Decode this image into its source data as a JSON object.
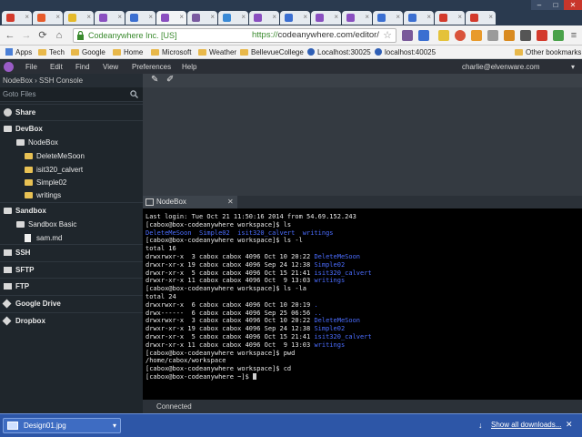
{
  "browser": {
    "ev_badge": "Codeanywhere Inc. [US]",
    "url_scheme": "https://",
    "url_rest": "codeanywhere.com/editor/"
  },
  "bookmarks": [
    "Apps",
    "Tech",
    "Google",
    "Home",
    "Microsoft",
    "Weather",
    "BellevueCollege",
    "Localhost:30025",
    "localhost:40025",
    "Other bookmarks"
  ],
  "app": {
    "menu": [
      "File",
      "Edit",
      "Find",
      "View",
      "Preferences",
      "Help"
    ],
    "user": "charlie@elvenware.com"
  },
  "sidebar": {
    "breadcrumb": "NodeBox › SSH Console",
    "goto_label": "Goto Files",
    "items": [
      {
        "label": "Share",
        "kind": "section",
        "icon": "share-icon"
      },
      {
        "label": "DevBox",
        "kind": "section",
        "icon": "devbox-icon"
      },
      {
        "label": "NodeBox",
        "kind": "container",
        "icon": "container-icon"
      },
      {
        "label": "DeleteMeSoon",
        "kind": "folder",
        "icon": "folder-icon"
      },
      {
        "label": "isit320_calvert",
        "kind": "folder",
        "icon": "folder-icon"
      },
      {
        "label": "Simple02",
        "kind": "folder",
        "icon": "folder-icon"
      },
      {
        "label": "writings",
        "kind": "folder",
        "icon": "folder-icon"
      },
      {
        "label": "Sandbox",
        "kind": "section",
        "icon": "sandbox-icon"
      },
      {
        "label": "Sandbox Basic",
        "kind": "container",
        "icon": "container-icon"
      },
      {
        "label": "sam.md",
        "kind": "file",
        "icon": "file-icon"
      },
      {
        "label": "SSH",
        "kind": "section",
        "icon": "ssh-icon"
      },
      {
        "label": "SFTP",
        "kind": "section",
        "icon": "sftp-icon"
      },
      {
        "label": "FTP",
        "kind": "section",
        "icon": "ftp-icon"
      },
      {
        "label": "Google Drive",
        "kind": "section",
        "icon": "google-drive-icon"
      },
      {
        "label": "Dropbox",
        "kind": "section",
        "icon": "dropbox-icon"
      }
    ]
  },
  "terminal": {
    "tab_label": "NodeBox",
    "status": "Connected",
    "lines": [
      [
        [
          "Last login: Tue Oct 21 11:50:16 2014 from 54.69.152.243",
          ""
        ]
      ],
      [
        [
          "[cabox@box-codeanywhere workspace]$ ls",
          ""
        ]
      ],
      [
        [
          "DeleteMeSoon  Simple02  isit320_calvert  writings",
          "blue"
        ]
      ],
      [
        [
          "[cabox@box-codeanywhere workspace]$ ls -l",
          ""
        ]
      ],
      [
        [
          "total 16",
          ""
        ]
      ],
      [
        [
          "drwxrwxr-x  3 cabox cabox 4096 Oct 10 20:22 ",
          ""
        ],
        [
          "DeleteMeSoon",
          "blue"
        ]
      ],
      [
        [
          "drwxr-xr-x 19 cabox cabox 4096 Sep 24 12:38 ",
          ""
        ],
        [
          "Simple02",
          "blue"
        ]
      ],
      [
        [
          "drwxr-xr-x  5 cabox cabox 4096 Oct 15 21:41 ",
          ""
        ],
        [
          "isit320_calvert",
          "blue"
        ]
      ],
      [
        [
          "drwxr-xr-x 11 cabox cabox 4096 Oct  9 13:03 ",
          ""
        ],
        [
          "writings",
          "blue"
        ]
      ],
      [
        [
          "[cabox@box-codeanywhere workspace]$ ls -la",
          ""
        ]
      ],
      [
        [
          "total 24",
          ""
        ]
      ],
      [
        [
          "drwxrwxr-x  6 cabox cabox 4096 Oct 10 20:19 ",
          ""
        ],
        [
          ".",
          "blue"
        ]
      ],
      [
        [
          "drwx------  6 cabox cabox 4096 Sep 25 06:56 ",
          ""
        ],
        [
          "..",
          "blue"
        ]
      ],
      [
        [
          "drwxrwxr-x  3 cabox cabox 4096 Oct 10 20:22 ",
          ""
        ],
        [
          "DeleteMeSoon",
          "blue"
        ]
      ],
      [
        [
          "drwxr-xr-x 19 cabox cabox 4096 Sep 24 12:38 ",
          ""
        ],
        [
          "Simple02",
          "blue"
        ]
      ],
      [
        [
          "drwxr-xr-x  5 cabox cabox 4096 Oct 15 21:41 ",
          ""
        ],
        [
          "isit320_calvert",
          "blue"
        ]
      ],
      [
        [
          "drwxr-xr-x 11 cabox cabox 4096 Oct  9 13:03 ",
          ""
        ],
        [
          "writings",
          "blue"
        ]
      ],
      [
        [
          "[cabox@box-codeanywhere workspace]$ pwd",
          ""
        ]
      ],
      [
        [
          "/home/cabox/workspace",
          ""
        ]
      ],
      [
        [
          "[cabox@box-codeanywhere workspace]$ cd",
          ""
        ]
      ],
      [
        [
          "[cabox@box-codeanywhere ~]$ ",
          ""
        ]
      ]
    ]
  },
  "downloads": {
    "file": "Design01.jpg",
    "show_all": "Show all downloads..."
  },
  "colors": {
    "terminal_blue": "#4b6dff",
    "ev_green": "#3a8a2e",
    "shelf_blue": "#2d56a7"
  }
}
